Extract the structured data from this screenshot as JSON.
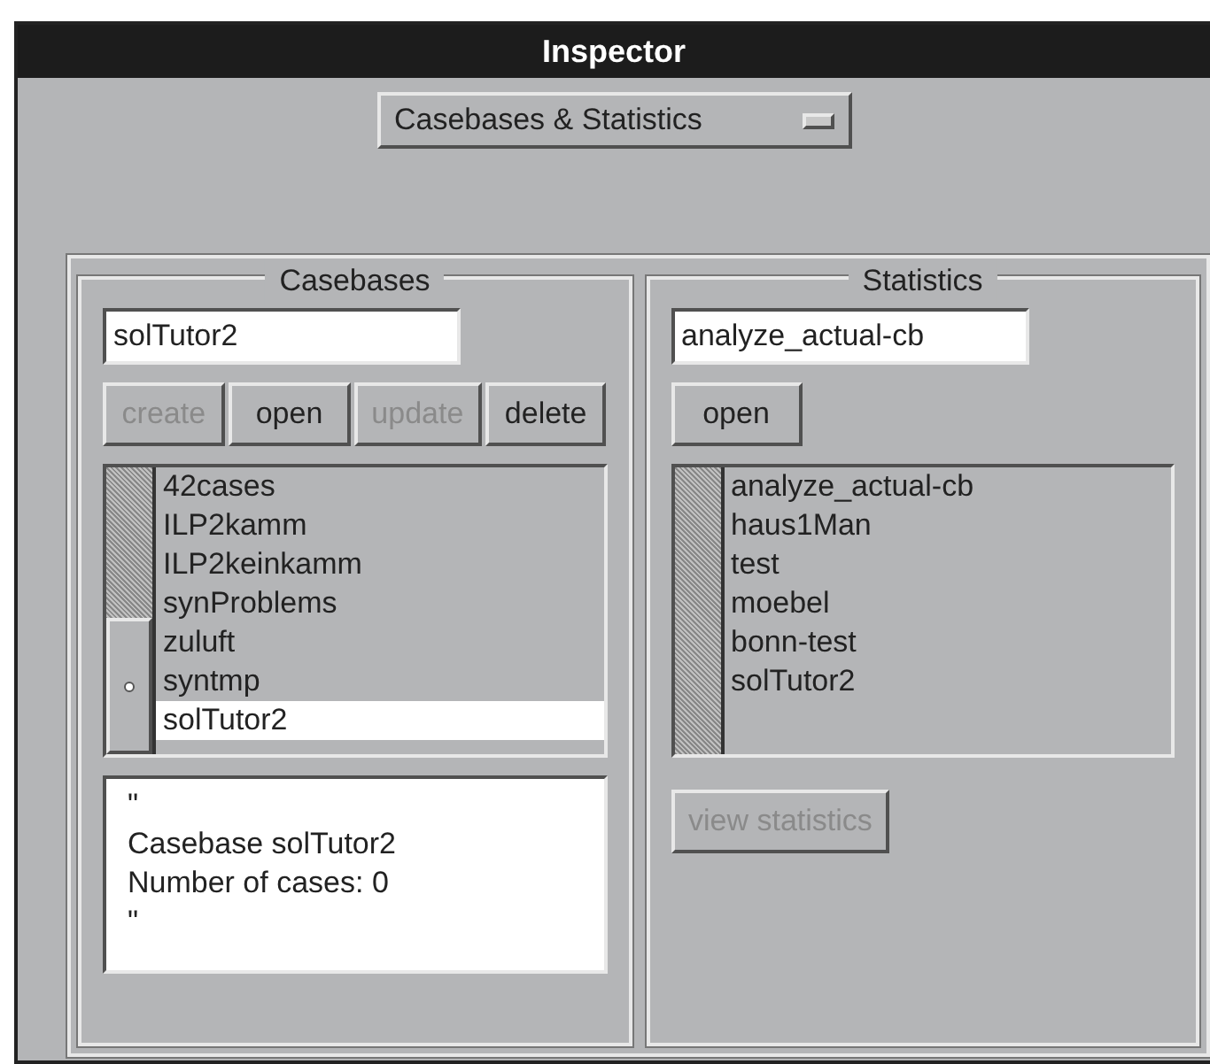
{
  "window": {
    "title": "Inspector"
  },
  "view_menu": {
    "value": "Casebases & Statistics"
  },
  "casebases": {
    "title": "Casebases",
    "name_field": {
      "value": "solTutor2"
    },
    "buttons": [
      {
        "label": "create",
        "disabled": true
      },
      {
        "label": "open",
        "disabled": false
      },
      {
        "label": "update",
        "disabled": true
      },
      {
        "label": "delete",
        "disabled": false
      }
    ],
    "items": [
      {
        "label": "42cases",
        "selected": false
      },
      {
        "label": "ILP2kamm",
        "selected": false
      },
      {
        "label": "ILP2keinkamm",
        "selected": false
      },
      {
        "label": "synProblems",
        "selected": false
      },
      {
        "label": "zuluft",
        "selected": false
      },
      {
        "label": "syntmp",
        "selected": false
      },
      {
        "label": "solTutor2",
        "selected": true
      }
    ],
    "info_lines": [
      "\"",
      "Casebase solTutor2",
      "Number of cases: 0",
      "\""
    ]
  },
  "statistics": {
    "title": "Statistics",
    "name_field": {
      "value": "analyze_actual-cb"
    },
    "buttons": [
      {
        "label": "open",
        "disabled": false
      }
    ],
    "items": [
      {
        "label": "analyze_actual-cb",
        "selected": false
      },
      {
        "label": "haus1Man",
        "selected": false
      },
      {
        "label": "test",
        "selected": false
      },
      {
        "label": "moebel",
        "selected": false
      },
      {
        "label": "bonn-test",
        "selected": false
      },
      {
        "label": "solTutor2",
        "selected": false
      }
    ],
    "view_button": {
      "label": "view statistics",
      "disabled": true
    }
  }
}
